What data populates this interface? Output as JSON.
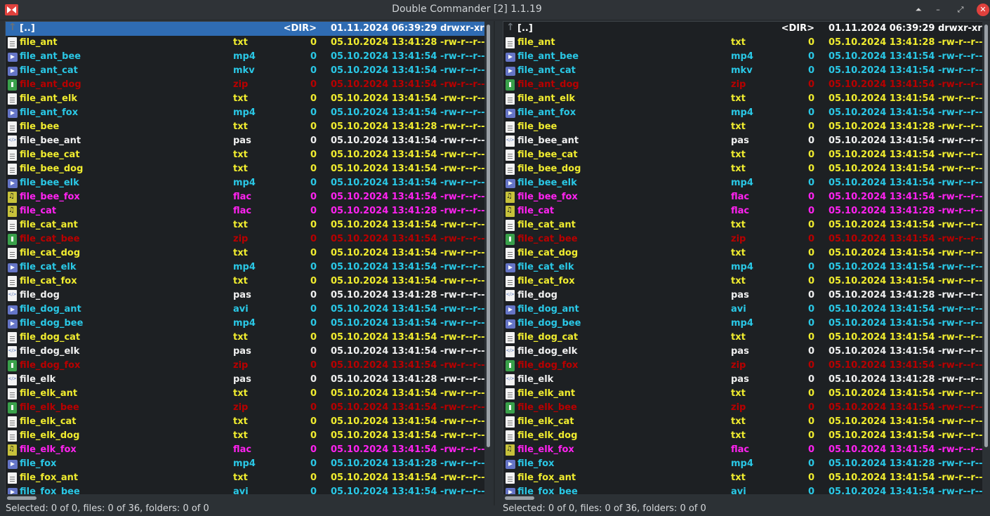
{
  "window": {
    "title": "Double Commander [2] 1.1.19"
  },
  "updir": {
    "name": "[..]",
    "size": "<DIR>",
    "date": "01.11.2024 06:39:29",
    "attr": "drwxr-xr-x"
  },
  "files": [
    {
      "name": "file_ant",
      "ext": "txt",
      "size": "0",
      "date": "05.10.2024 13:41:28",
      "attr": "-rw-r--r--",
      "kind": "txt"
    },
    {
      "name": "file_ant_bee",
      "ext": "mp4",
      "size": "0",
      "date": "05.10.2024 13:41:54",
      "attr": "-rw-r--r--",
      "kind": "vid"
    },
    {
      "name": "file_ant_cat",
      "ext": "mkv",
      "size": "0",
      "date": "05.10.2024 13:41:54",
      "attr": "-rw-r--r--",
      "kind": "vid"
    },
    {
      "name": "file_ant_dog",
      "ext": "zip",
      "size": "0",
      "date": "05.10.2024 13:41:54",
      "attr": "-rw-r--r--",
      "kind": "zip"
    },
    {
      "name": "file_ant_elk",
      "ext": "txt",
      "size": "0",
      "date": "05.10.2024 13:41:54",
      "attr": "-rw-r--r--",
      "kind": "txt"
    },
    {
      "name": "file_ant_fox",
      "ext": "mp4",
      "size": "0",
      "date": "05.10.2024 13:41:54",
      "attr": "-rw-r--r--",
      "kind": "vid"
    },
    {
      "name": "file_bee",
      "ext": "txt",
      "size": "0",
      "date": "05.10.2024 13:41:28",
      "attr": "-rw-r--r--",
      "kind": "txt"
    },
    {
      "name": "file_bee_ant",
      "ext": "pas",
      "size": "0",
      "date": "05.10.2024 13:41:54",
      "attr": "-rw-r--r--",
      "kind": "pas"
    },
    {
      "name": "file_bee_cat",
      "ext": "txt",
      "size": "0",
      "date": "05.10.2024 13:41:54",
      "attr": "-rw-r--r--",
      "kind": "txt"
    },
    {
      "name": "file_bee_dog",
      "ext": "txt",
      "size": "0",
      "date": "05.10.2024 13:41:54",
      "attr": "-rw-r--r--",
      "kind": "txt"
    },
    {
      "name": "file_bee_elk",
      "ext": "mp4",
      "size": "0",
      "date": "05.10.2024 13:41:54",
      "attr": "-rw-r--r--",
      "kind": "vid"
    },
    {
      "name": "file_bee_fox",
      "ext": "flac",
      "size": "0",
      "date": "05.10.2024 13:41:54",
      "attr": "-rw-r--r--",
      "kind": "flac"
    },
    {
      "name": "file_cat",
      "ext": "flac",
      "size": "0",
      "date": "05.10.2024 13:41:28",
      "attr": "-rw-r--r--",
      "kind": "flac"
    },
    {
      "name": "file_cat_ant",
      "ext": "txt",
      "size": "0",
      "date": "05.10.2024 13:41:54",
      "attr": "-rw-r--r--",
      "kind": "txt"
    },
    {
      "name": "file_cat_bee",
      "ext": "zip",
      "size": "0",
      "date": "05.10.2024 13:41:54",
      "attr": "-rw-r--r--",
      "kind": "zip"
    },
    {
      "name": "file_cat_dog",
      "ext": "txt",
      "size": "0",
      "date": "05.10.2024 13:41:54",
      "attr": "-rw-r--r--",
      "kind": "txt"
    },
    {
      "name": "file_cat_elk",
      "ext": "mp4",
      "size": "0",
      "date": "05.10.2024 13:41:54",
      "attr": "-rw-r--r--",
      "kind": "vid"
    },
    {
      "name": "file_cat_fox",
      "ext": "txt",
      "size": "0",
      "date": "05.10.2024 13:41:54",
      "attr": "-rw-r--r--",
      "kind": "txt"
    },
    {
      "name": "file_dog",
      "ext": "pas",
      "size": "0",
      "date": "05.10.2024 13:41:28",
      "attr": "-rw-r--r--",
      "kind": "pas"
    },
    {
      "name": "file_dog_ant",
      "ext": "avi",
      "size": "0",
      "date": "05.10.2024 13:41:54",
      "attr": "-rw-r--r--",
      "kind": "vid"
    },
    {
      "name": "file_dog_bee",
      "ext": "mp4",
      "size": "0",
      "date": "05.10.2024 13:41:54",
      "attr": "-rw-r--r--",
      "kind": "vid"
    },
    {
      "name": "file_dog_cat",
      "ext": "txt",
      "size": "0",
      "date": "05.10.2024 13:41:54",
      "attr": "-rw-r--r--",
      "kind": "txt"
    },
    {
      "name": "file_dog_elk",
      "ext": "pas",
      "size": "0",
      "date": "05.10.2024 13:41:54",
      "attr": "-rw-r--r--",
      "kind": "pas"
    },
    {
      "name": "file_dog_fox",
      "ext": "zip",
      "size": "0",
      "date": "05.10.2024 13:41:54",
      "attr": "-rw-r--r--",
      "kind": "zip"
    },
    {
      "name": "file_elk",
      "ext": "pas",
      "size": "0",
      "date": "05.10.2024 13:41:28",
      "attr": "-rw-r--r--",
      "kind": "pas"
    },
    {
      "name": "file_elk_ant",
      "ext": "txt",
      "size": "0",
      "date": "05.10.2024 13:41:54",
      "attr": "-rw-r--r--",
      "kind": "txt"
    },
    {
      "name": "file_elk_bee",
      "ext": "zip",
      "size": "0",
      "date": "05.10.2024 13:41:54",
      "attr": "-rw-r--r--",
      "kind": "zip"
    },
    {
      "name": "file_elk_cat",
      "ext": "txt",
      "size": "0",
      "date": "05.10.2024 13:41:54",
      "attr": "-rw-r--r--",
      "kind": "txt"
    },
    {
      "name": "file_elk_dog",
      "ext": "txt",
      "size": "0",
      "date": "05.10.2024 13:41:54",
      "attr": "-rw-r--r--",
      "kind": "txt"
    },
    {
      "name": "file_elk_fox",
      "ext": "flac",
      "size": "0",
      "date": "05.10.2024 13:41:54",
      "attr": "-rw-r--r--",
      "kind": "flac"
    },
    {
      "name": "file_fox",
      "ext": "mp4",
      "size": "0",
      "date": "05.10.2024 13:41:28",
      "attr": "-rw-r--r--",
      "kind": "vid"
    },
    {
      "name": "file_fox_ant",
      "ext": "txt",
      "size": "0",
      "date": "05.10.2024 13:41:54",
      "attr": "-rw-r--r--",
      "kind": "txt"
    },
    {
      "name": "file_fox_bee",
      "ext": "avi",
      "size": "0",
      "date": "05.10.2024 13:41:54",
      "attr": "-rw-r--r--",
      "kind": "vid"
    }
  ],
  "panels": {
    "left": {
      "status": "Selected: 0 of 0, files: 0 of 36, folders: 0 of 0",
      "selected_row": 0
    },
    "right": {
      "status": "Selected: 0 of 0, files: 0 of 36, folders: 0 of 0",
      "selected_row": -1
    }
  },
  "colors": {
    "selection": "#2f6cb3",
    "txt": "#f0ec2f",
    "video": "#2ac8e6",
    "archive": "#b80000",
    "audio": "#ff22f0",
    "source": "#f0f0f0"
  }
}
